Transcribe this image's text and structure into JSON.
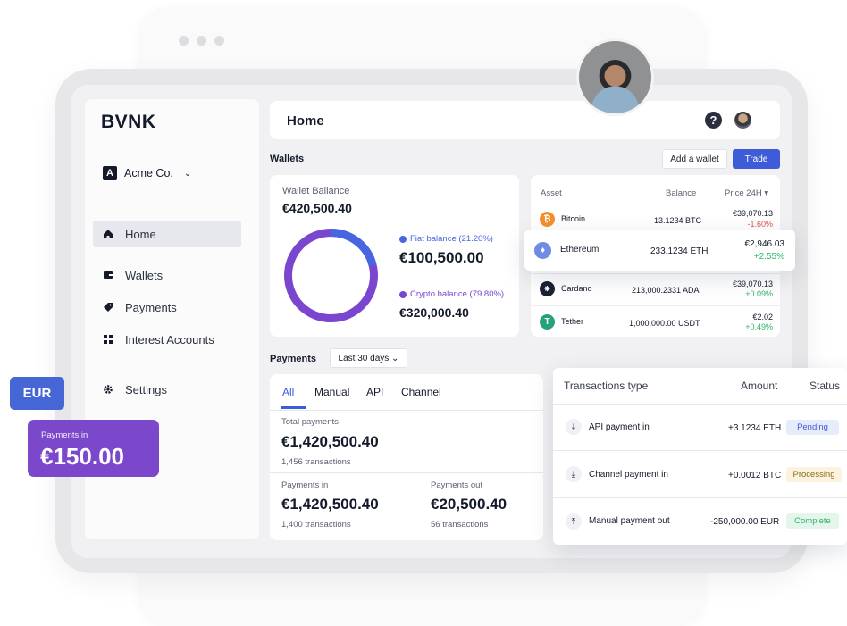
{
  "brand": "BVNK",
  "org": {
    "initial": "A",
    "name": "Acme Co."
  },
  "nav": [
    {
      "label": "Home",
      "icon": "home-icon"
    },
    {
      "label": "Wallets",
      "icon": "wallet-icon"
    },
    {
      "label": "Payments",
      "icon": "tag-icon"
    },
    {
      "label": "Interest Accounts",
      "icon": "grid-icon"
    },
    {
      "label": "Settings",
      "icon": "gear-icon"
    }
  ],
  "header": {
    "title": "Home",
    "help": "?"
  },
  "wallets": {
    "label": "Wallets",
    "add_button": "Add a wallet",
    "trade_button": "Trade",
    "balance_title": "Wallet Ballance",
    "balance_total": "€420,500.40",
    "fiat_label": "Fiat balance (21.20%)",
    "fiat_amount": "€100,500.00",
    "crypto_label": "Crypto balance (79.80%)",
    "crypto_amount": "€320,000.40",
    "fiat_share": 21.2,
    "colors": {
      "fiat": "#4766e0",
      "crypto": "#7a46cf"
    }
  },
  "assets": {
    "headers": {
      "asset": "Asset",
      "balance": "Balance",
      "price": "Price 24H"
    },
    "rows": [
      {
        "name": "Bitcoin",
        "balance": "13.1234 BTC",
        "price": "€39,070.13",
        "change": "-1.60%",
        "icon": "bitcoin-icon"
      },
      {
        "name": "Ethereum",
        "balance": "233.1234 ETH",
        "price": "€2,946.03",
        "change": "+2.55%",
        "icon": "ethereum-icon"
      },
      {
        "name": "Cardano",
        "balance": "213,000.2331 ADA",
        "price": "€39,070.13",
        "change": "+0.09%",
        "icon": "cardano-icon"
      },
      {
        "name": "Tether",
        "balance": "1,000,000.00 USDT",
        "price": "€2.02",
        "change": "+0.49%",
        "icon": "tether-icon"
      }
    ]
  },
  "payments": {
    "label": "Payments",
    "filter": "Last 30 days",
    "tabs": [
      "All",
      "Manual",
      "API",
      "Channel"
    ],
    "total_label": "Total payments",
    "total_amount": "€1,420,500.40",
    "total_count": "1,456 transactions",
    "in_label": "Payments in",
    "in_amount": "€1,420,500.40",
    "in_count": "1,400 transactions",
    "out_label": "Payments out",
    "out_amount": "€20,500.40",
    "out_count": "56 transactions"
  },
  "transactions": {
    "headers": {
      "type": "Transactions type",
      "amount": "Amount",
      "status": "Status"
    },
    "rows": [
      {
        "type": "API payment in",
        "amount": "+3.1234 ETH",
        "status": "Pending"
      },
      {
        "type": "Channel payment in",
        "amount": "+0.0012 BTC",
        "status": "Processing"
      },
      {
        "type": "Manual payment out",
        "amount": "-250,000.00 EUR",
        "status": "Complete"
      }
    ]
  },
  "tags": {
    "currency": "EUR",
    "payments_in_label": "Payments in",
    "payments_in_amount": "€150.00"
  }
}
